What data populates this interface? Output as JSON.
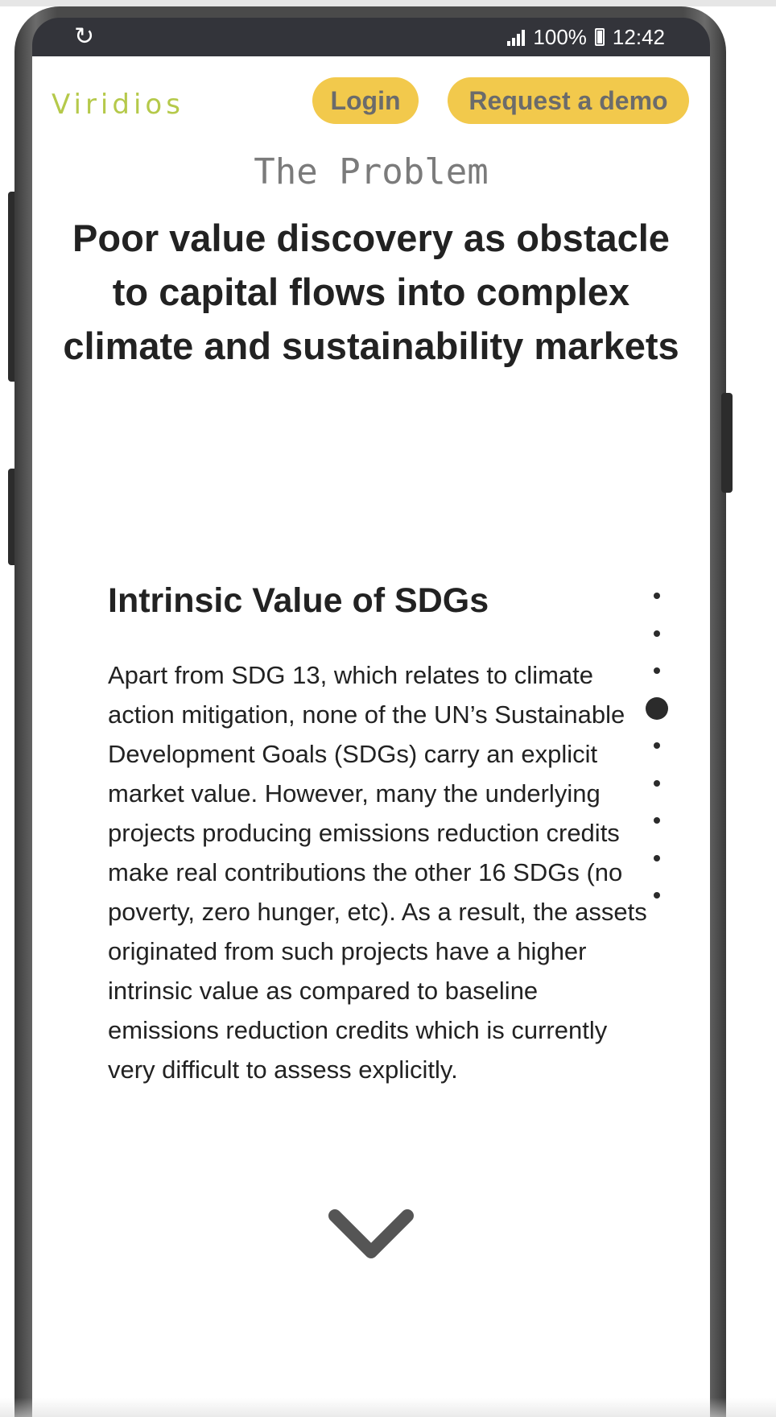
{
  "status_bar": {
    "battery": "100%",
    "time": "12:42",
    "icons": [
      "loading-icon",
      "signal-icon",
      "battery-icon"
    ]
  },
  "header": {
    "logo": "Viridios",
    "login_label": "Login",
    "demo_label": "Request a demo"
  },
  "hero": {
    "kicker": "The Problem",
    "headline": "Poor value discovery as obstacle to capital flows into complex climate and sustainability markets"
  },
  "section": {
    "title": "Intrinsic Value of SDGs",
    "body": "Apart from SDG 13, which relates to climate action mitigation, none of the UN’s Sustainable Development Goals (SDGs) carry an explicit market value. However, many the underlying projects producing emissions reduction credits make real contributions the other 16 SDGs (no poverty, zero hunger, etc). As a result, the assets originated from such projects have a higher intrinsic value as compared to baseline emissions reduction credits which is currently very difficult to assess explicitly."
  },
  "dot_nav": {
    "count": 9,
    "active_index": 3
  },
  "colors": {
    "accent_button": "#f2c94c",
    "logo_green": "#b5c94a",
    "text": "#222222",
    "kicker": "#7b7b7b"
  },
  "scroll_indicator": "chevron-down-icon"
}
